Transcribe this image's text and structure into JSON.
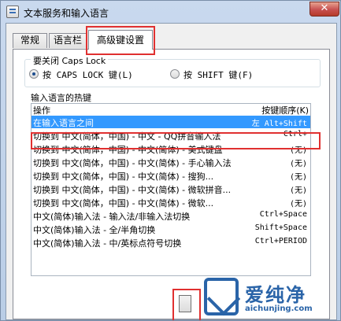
{
  "window": {
    "title": "文本服务和输入语言",
    "close_glyph": "✕"
  },
  "tabs": [
    {
      "label": "常规"
    },
    {
      "label": "语言栏"
    },
    {
      "label": "高级键设置"
    }
  ],
  "caps_lock": {
    "title": "要关闭 Caps Lock",
    "options": [
      {
        "label": "按 CAPS LOCK 键(L)",
        "selected": true
      },
      {
        "label": "按 SHIFT 键(F)",
        "selected": false
      }
    ]
  },
  "hotkeys": {
    "title": "输入语言的热键",
    "columns": {
      "action": "操作",
      "sequence": "按键顺序(K)"
    },
    "rows": [
      {
        "action": "在输入语言之间",
        "keys": "左 Alt+Shift",
        "selected": true
      },
      {
        "action": "切换到 中文(简体，中国) - 中文 - QQ拼音输入法",
        "keys": "Ctrl+"
      },
      {
        "action": "切换到 中文(简体，中国) - 中文(简体) - 美式键盘",
        "keys": "(无)"
      },
      {
        "action": "切换到 中文(简体，中国) - 中文(简体) - 手心输入法",
        "keys": "(无)"
      },
      {
        "action": "切换到 中文(简体，中国) - 中文(简体) - 搜狗...",
        "keys": "(无)"
      },
      {
        "action": "切换到 中文(简体，中国) - 中文(简体) - 微软拼音...",
        "keys": "(无)"
      },
      {
        "action": "切换到 中文(简体，中国) - 中文(简体) - 微软...",
        "keys": "(无)"
      },
      {
        "action": "中文(简体)输入法 - 输入法/非输入法切换",
        "keys": "Ctrl+Space"
      },
      {
        "action": "中文(简体)输入法 - 全/半角切换",
        "keys": "Shift+Space"
      },
      {
        "action": "中文(简体)输入法 - 中/英标点符号切换",
        "keys": "Ctrl+PERIOD"
      }
    ]
  },
  "watermark": {
    "brand": "爱纯净",
    "url": "aichunjing.com"
  },
  "colors": {
    "highlight": "#e03030",
    "selection": "#3399ff",
    "brand": "#2a64a8"
  }
}
